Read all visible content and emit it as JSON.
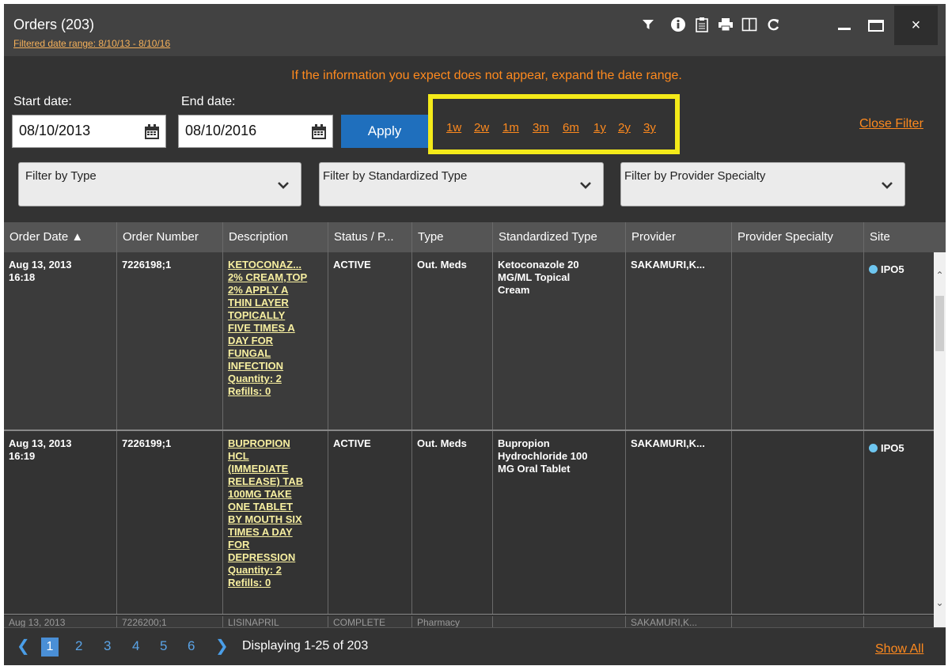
{
  "window": {
    "title": "Orders (203)",
    "subtitle": "Filtered date range: 8/10/13 - 8/10/16",
    "close_label": "×",
    "icons": [
      "filter-icon",
      "info-icon",
      "clipboard-icon",
      "print-icon",
      "columns-icon",
      "refresh-icon",
      "minimize-icon",
      "maximize-icon",
      "close-icon"
    ]
  },
  "filter": {
    "message": "If the information you expect does not appear, expand the date range.",
    "start_label": "Start date:",
    "start_value": "08/10/2013",
    "end_label": "End date:",
    "end_value": "08/10/2016",
    "apply_label": "Apply",
    "ranges": [
      "1w",
      "2w",
      "1m",
      "3m",
      "6m",
      "1y",
      "2y",
      "3y"
    ],
    "close_filter": "Close Filter",
    "type_placeholder": "Filter by Type",
    "std_type_placeholder": "Filter by Standardized Type",
    "specialty_placeholder": "Filter by Provider Specialty"
  },
  "table": {
    "columns": [
      "Order Date ▲",
      "Order Number",
      "Description",
      "Status / P...",
      "Type",
      "Standardized Type",
      "Provider",
      "Provider Specialty",
      "Site"
    ],
    "rows": [
      {
        "date1": "Aug 13, 2013",
        "date2": "16:18",
        "number": "7226198;1",
        "desc": [
          "KETOCONAZ...",
          "2% CREAM,TOP",
          "2% APPLY A",
          "THIN LAYER",
          "TOPICALLY",
          "FIVE TIMES A",
          "DAY FOR",
          "FUNGAL",
          "INFECTION",
          "Quantity: 2",
          "Refills: 0"
        ],
        "status": "ACTIVE",
        "type": "Out. Meds",
        "std_type": [
          "Ketoconazole 20",
          "MG/ML Topical",
          "Cream"
        ],
        "provider": "SAKAMURI,K...",
        "specialty": "",
        "site": "IPO5"
      },
      {
        "date1": "Aug 13, 2013",
        "date2": "16:19",
        "number": "7226199;1",
        "desc": [
          "BUPROPION",
          "HCL",
          "(IMMEDIATE",
          "RELEASE) TAB",
          "100MG TAKE",
          "ONE TABLET",
          "BY MOUTH SIX",
          "TIMES A DAY",
          "FOR",
          "DEPRESSION",
          "Quantity: 2",
          "Refills: 0"
        ],
        "status": "ACTIVE",
        "type": "Out. Meds",
        "std_type": [
          "Bupropion",
          "Hydrochloride 100",
          "MG Oral Tablet"
        ],
        "provider": "SAKAMURI,K...",
        "specialty": "",
        "site": "IPO5"
      },
      {
        "date1": "Aug 13, 2013",
        "number": "7226200;1",
        "desc0": "LISINAPRIL",
        "status": "COMPLETE",
        "type": "Pharmacy",
        "provider": "SAKAMURI,K..."
      }
    ]
  },
  "pagination": {
    "pages": [
      "1",
      "2",
      "3",
      "4",
      "5",
      "6"
    ],
    "displaying": "Displaying 1-25 of 203",
    "show_all": "Show All"
  },
  "colors": {
    "accent_orange": "#ff8a1e",
    "apply_blue": "#1f6fbd",
    "highlight_yellow": "#f4ea19",
    "site_dot": "#6ec6f0"
  }
}
